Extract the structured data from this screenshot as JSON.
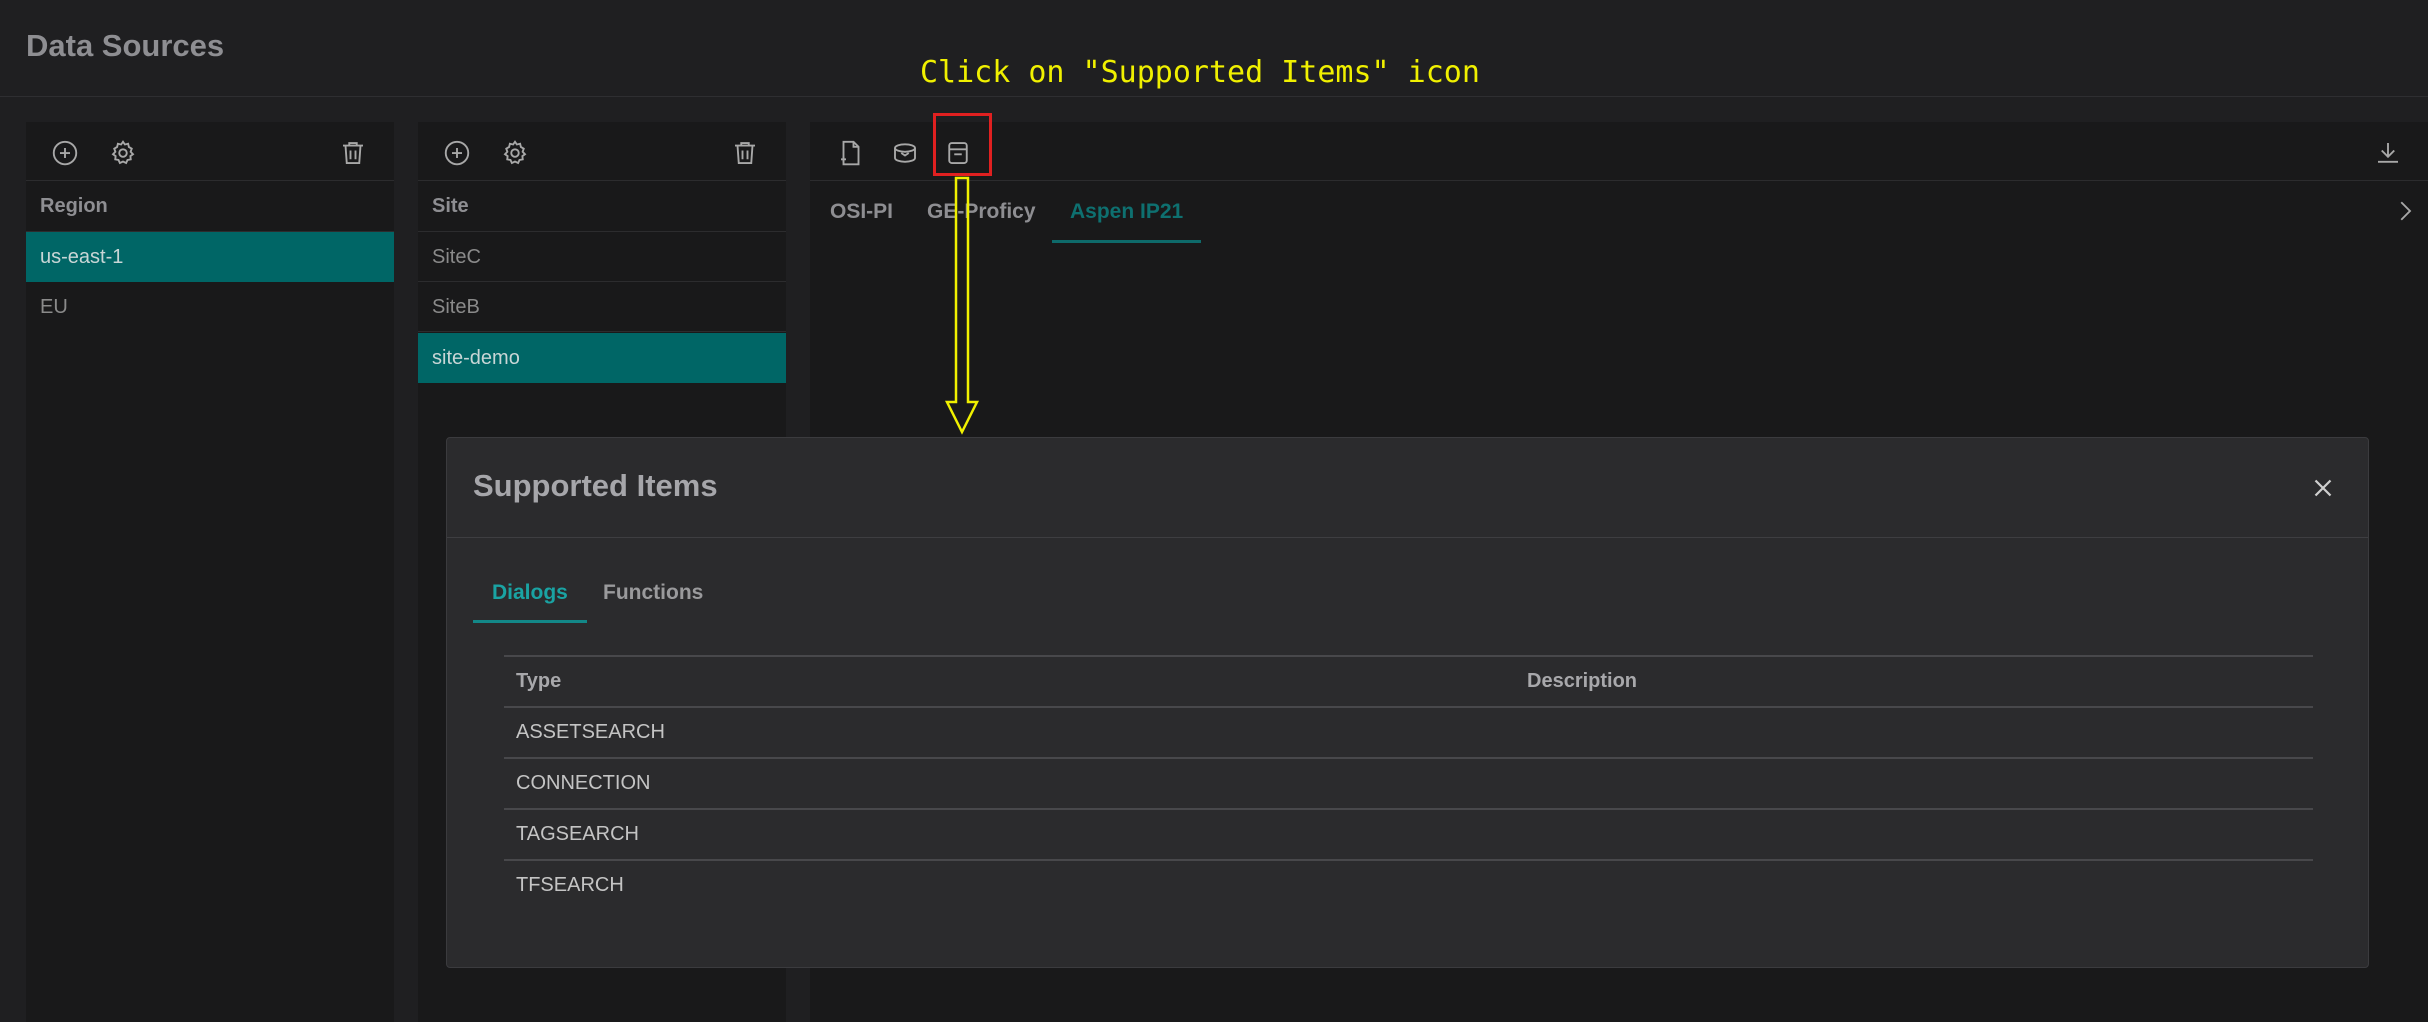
{
  "page": {
    "title": "Data Sources"
  },
  "annotation": {
    "text": "Click on \"Supported Items\" icon",
    "color": "#f0f000",
    "highlight_color": "#e02020"
  },
  "region_panel": {
    "toolbar": [
      "add-icon",
      "gear-icon",
      "trash-icon"
    ],
    "header": "Region",
    "items": [
      {
        "label": "us-east-1",
        "selected": true
      },
      {
        "label": "EU",
        "selected": false
      }
    ]
  },
  "site_panel": {
    "toolbar": [
      "add-icon",
      "gear-icon",
      "trash-icon"
    ],
    "header": "Site",
    "items": [
      {
        "label": "SiteC",
        "selected": false
      },
      {
        "label": "SiteB",
        "selected": false
      },
      {
        "label": "site-demo",
        "selected": true
      }
    ]
  },
  "source_panel": {
    "toolbar": [
      "new-file-icon",
      "database-icon",
      "supported-items-icon",
      "download-icon"
    ],
    "tabs": [
      {
        "label": "OSI-PI",
        "active": false
      },
      {
        "label": "GE-Proficy",
        "active": false
      },
      {
        "label": "Aspen IP21",
        "active": true
      }
    ]
  },
  "modal": {
    "title": "Supported Items",
    "tabs": [
      {
        "label": "Dialogs",
        "active": true
      },
      {
        "label": "Functions",
        "active": false
      }
    ],
    "table": {
      "columns": [
        "Type",
        "Description"
      ],
      "rows": [
        [
          "ASSETSEARCH",
          ""
        ],
        [
          "CONNECTION",
          ""
        ],
        [
          "TAGSEARCH",
          ""
        ],
        [
          "TFSEARCH",
          ""
        ]
      ]
    }
  },
  "colors": {
    "accent": "#006666",
    "background": "#1f1f21",
    "panel": "#19191a",
    "modal": "#2b2b2d"
  }
}
